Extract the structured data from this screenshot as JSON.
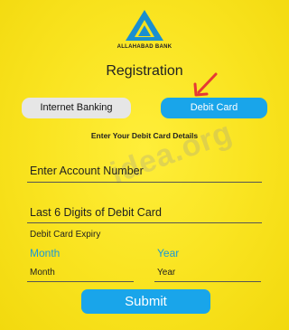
{
  "brand": {
    "logo_text": "ALLAHABAD BANK"
  },
  "page": {
    "title": "Registration"
  },
  "tabs": {
    "internet_banking": "Internet Banking",
    "debit_card": "Debit Card"
  },
  "section": {
    "heading": "Enter Your Debit Card Details"
  },
  "form": {
    "account_number_placeholder": "Enter Account Number",
    "card_digits_placeholder": "Last 6 Digits of Debit Card",
    "expiry_label": "Debit Card Expiry",
    "month_hint": "Month",
    "year_hint": "Year",
    "month_value": "Month",
    "year_value": "Year"
  },
  "actions": {
    "submit_label": "Submit"
  },
  "watermark": "idea.org",
  "colors": {
    "background": "#f7e21c",
    "accent": "#19a5ea",
    "arrow": "#e53935",
    "tab_inactive": "#e6e6e6"
  }
}
